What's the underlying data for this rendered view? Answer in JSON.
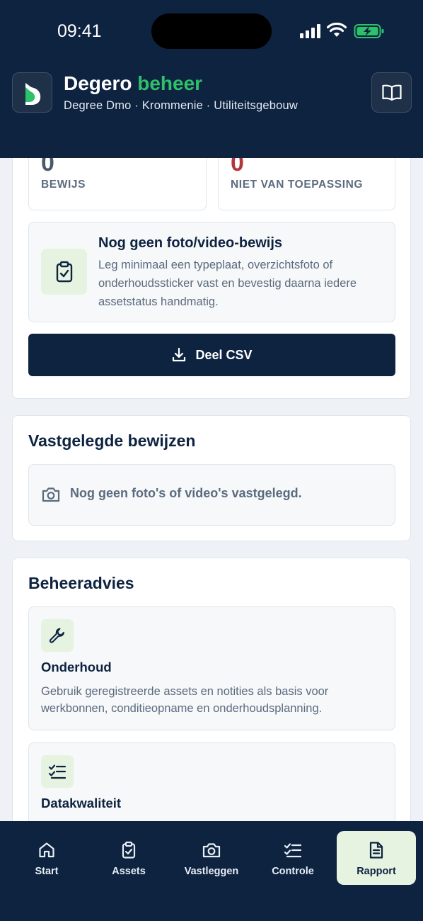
{
  "status_bar": {
    "time": "09:41"
  },
  "header": {
    "brand_primary": "Degero",
    "brand_accent": "beheer",
    "subtitle": "Degree Dmo · Krommenie · Utiliteitsgebouw",
    "logo_icon": "degero-logo-icon",
    "guide_icon": "book-open-icon"
  },
  "stats": [
    {
      "value": "0",
      "label": "BEWIJS",
      "color": "#4a5a6e"
    },
    {
      "value": "0",
      "label": "NIET VAN TOEPASSING",
      "color": "#b3363d"
    }
  ],
  "notice": {
    "icon": "clipboard-check-icon",
    "title": "Nog geen foto/video-bewijs",
    "body": "Leg minimaal een typeplaat, overzichtsfoto of onderhoudssticker vast en bevestig daarna iedere assetstatus handmatig."
  },
  "share_csv": {
    "label": "Deel CSV",
    "icon": "download-icon"
  },
  "evidence_section": {
    "title": "Vastgelegde bewijzen",
    "empty_icon": "camera-icon",
    "empty_text": "Nog geen foto's of video's vastgelegd."
  },
  "advice_section": {
    "title": "Beheeradvies",
    "items": [
      {
        "icon": "wrench-icon",
        "title": "Onderhoud",
        "body": "Gebruik geregistreerde assets en notities als basis voor werkbonnen, conditieopname en onderhoudsplanning."
      },
      {
        "icon": "checklist-icon",
        "title": "Datakwaliteit",
        "body": ""
      }
    ]
  },
  "tabs": [
    {
      "label": "Start",
      "icon": "home-icon",
      "active": false
    },
    {
      "label": "Assets",
      "icon": "clipboard-check-icon",
      "active": false
    },
    {
      "label": "Vastleggen",
      "icon": "camera-icon",
      "active": false
    },
    {
      "label": "Controle",
      "icon": "checklist-icon",
      "active": false
    },
    {
      "label": "Rapport",
      "icon": "document-icon",
      "active": true
    }
  ],
  "colors": {
    "navy": "#0d2340",
    "accent_green": "#2ec06a",
    "soft_green": "#e7f3e1",
    "danger_red": "#b3363d",
    "muted_text": "#5b6b7e"
  }
}
